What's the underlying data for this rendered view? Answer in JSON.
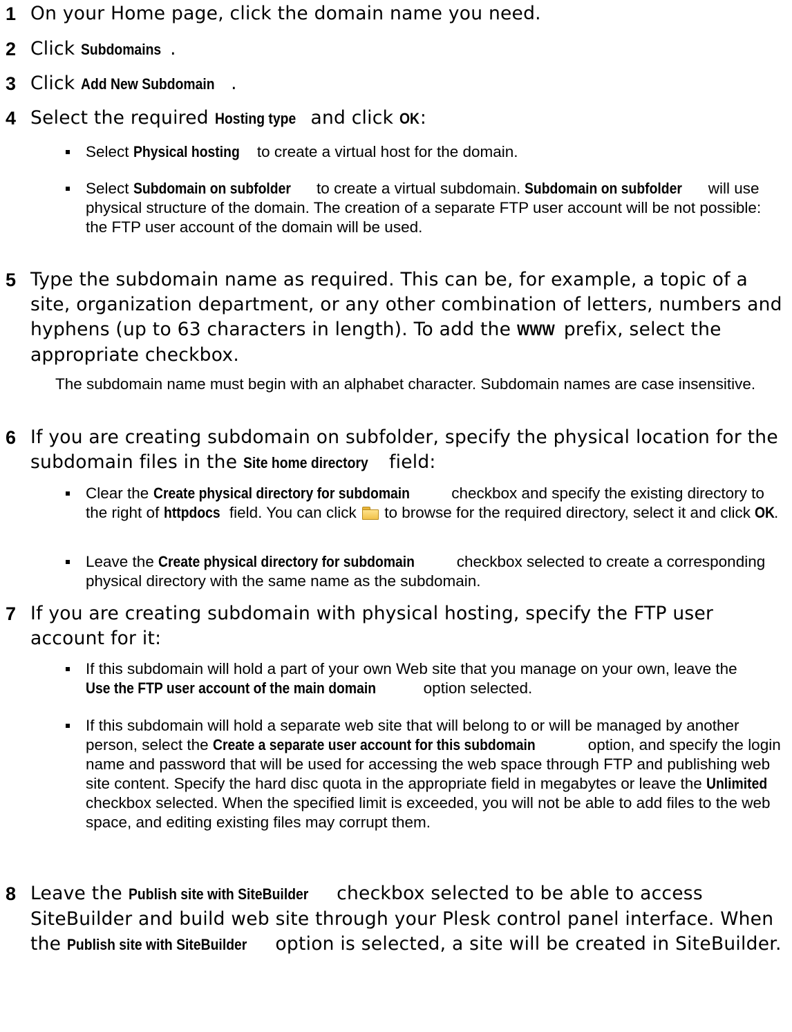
{
  "steps": [
    {
      "number": "1",
      "parts": [
        "On your Home page, click the domain name you need."
      ]
    },
    {
      "number": "2",
      "parts": [
        "Click ",
        "Subdomains",
        "."
      ]
    },
    {
      "number": "3",
      "parts": [
        "Click ",
        "Add New Subdomain",
        "."
      ]
    },
    {
      "number": "4",
      "parts": [
        "Select the required ",
        "Hosting type",
        " and click ",
        "OK",
        ":"
      ],
      "bullets": [
        {
          "parts": [
            "Select ",
            "Physical hosting",
            " to create a virtual host for the domain."
          ]
        },
        {
          "parts": [
            "Select ",
            "Subdomain on subfolder",
            " to create a virtual subdomain.  ",
            "Subdomain on subfolder",
            " will use physical structure of the domain. The creation of a separate FTP user account will be not possible: the FTP user account of the domain will be used."
          ]
        }
      ]
    },
    {
      "number": "5",
      "parts": [
        "Type the subdomain name as required. This can be, for example, a topic of a site, organization department, or any other combination of letters, numbers and hyphens (up to 63 characters in length). To add the ",
        "WWW",
        " prefix, select the appropriate checkbox."
      ],
      "note": "The subdomain name must begin with an alphabet character. Subdomain names are case insensitive."
    },
    {
      "number": "6",
      "parts": [
        "If you are creating subdomain on subfolder, specify the physical location for the subdomain files in the ",
        "Site home directory",
        " field:"
      ],
      "bullets": [
        {
          "parts": [
            "Clear the ",
            "Create physical directory for subdomain",
            " checkbox and specify the existing directory to the right of ",
            "httpdocs",
            " field. You can click ",
            " to browse for the required directory, select it and click ",
            "OK",
            "."
          ],
          "icon": "folder-icon"
        },
        {
          "parts": [
            "Leave the ",
            "Create physical directory for subdomain",
            " checkbox selected to create a corresponding physical directory with the same name as the subdomain."
          ]
        }
      ]
    },
    {
      "number": "7",
      "parts": [
        "If you are creating subdomain with physical hosting, specify the FTP user account for it:"
      ],
      "bullets": [
        {
          "parts": [
            "If this subdomain will hold a part of your own Web site that you manage on your own, leave the ",
            "Use the FTP user account of the main domain",
            " option selected."
          ]
        },
        {
          "parts": [
            "If this subdomain will hold a separate web site that will belong to or will be managed by another person, select the ",
            "Create a separate user account for this subdomain",
            " option, and specify the login name and password that will be used for accessing the web space through FTP and publishing web site content. Specify the hard disc quota in the appropriate field in megabytes or leave the ",
            "Unlimited",
            " checkbox selected. When the specified limit is exceeded, you will not be able to add files to the web space, and editing existing files may corrupt them."
          ]
        }
      ]
    },
    {
      "number": "8",
      "parts": [
        "Leave the ",
        "Publish site with SiteBuilder",
        " checkbox selected to be able to access SiteBuilder and build web site through your Plesk control panel interface. When the ",
        "Publish site with SiteBuilder",
        " option is selected, a site will be created in SiteBuilder."
      ]
    }
  ]
}
